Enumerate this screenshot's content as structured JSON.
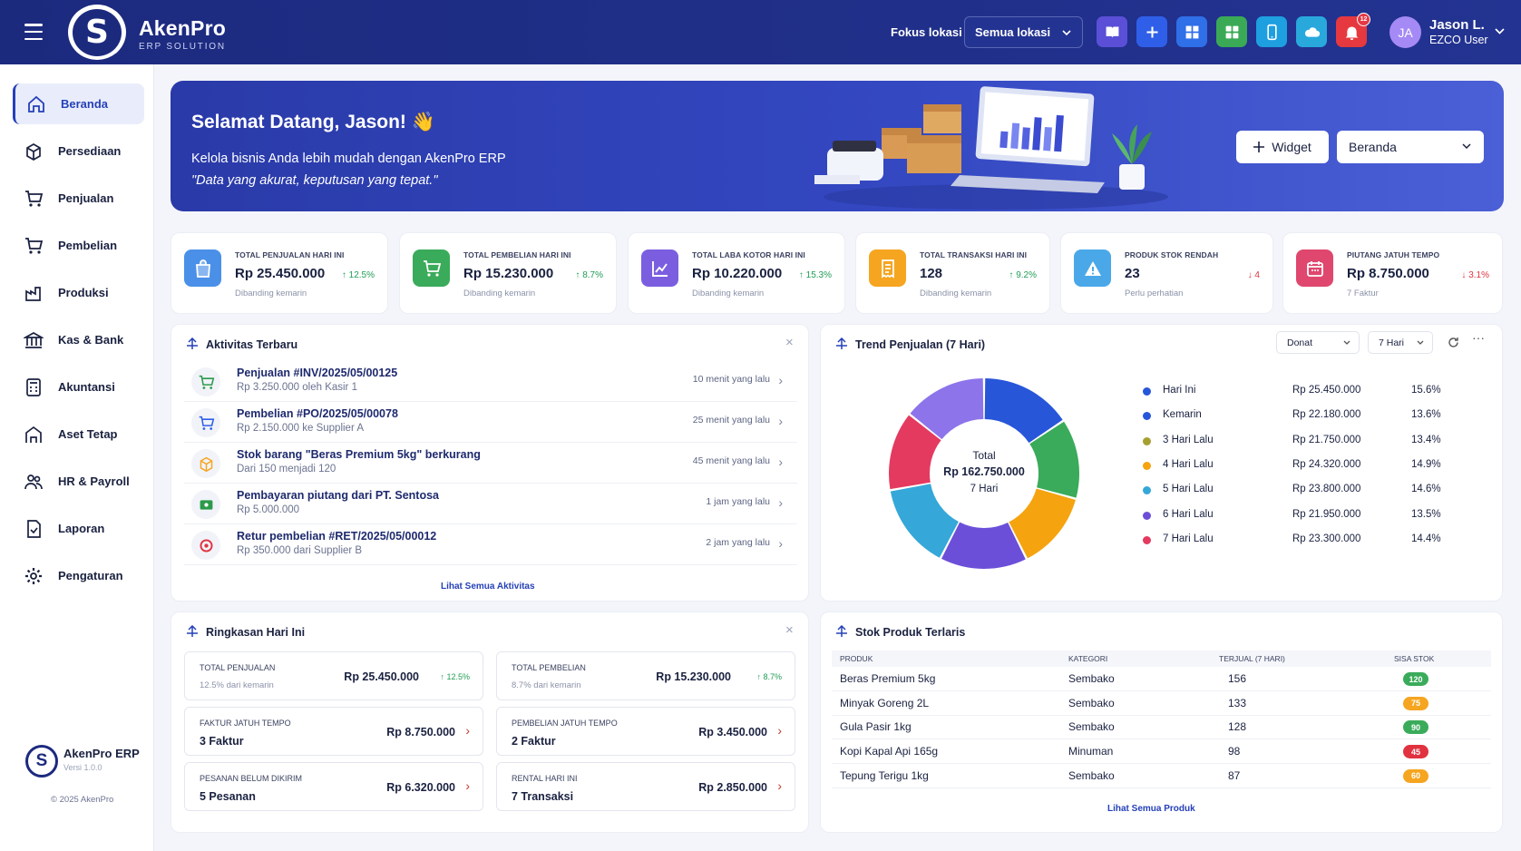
{
  "app": {
    "name": "AkenPro",
    "tagline": "ERP SOLUTION",
    "logo_letter": "S"
  },
  "topbar": {
    "focus_label": "Fokus lokasi",
    "location_select": "Semua lokasi",
    "notification_count": "12",
    "buttons": [
      {
        "icon": "book-icon",
        "color": "#5a4fd6"
      },
      {
        "icon": "plus-icon",
        "color": "#2f5fe8"
      },
      {
        "icon": "grid-icon",
        "color": "#2f6fe8"
      },
      {
        "icon": "apps-icon",
        "color": "#3aaa57"
      },
      {
        "icon": "mobile-icon",
        "color": "#1e9fe0"
      },
      {
        "icon": "cloud-icon",
        "color": "#29a8dc"
      },
      {
        "icon": "bell-icon",
        "color": "#e5393f"
      }
    ],
    "user": {
      "initials": "JA",
      "name": "Jason L.",
      "role": "EZCO User"
    }
  },
  "sidebar": {
    "items": [
      {
        "label": "Beranda",
        "icon": "home-icon",
        "active": true
      },
      {
        "label": "Persediaan",
        "icon": "box-icon"
      },
      {
        "label": "Penjualan",
        "icon": "cart-icon"
      },
      {
        "label": "Pembelian",
        "icon": "cart-icon"
      },
      {
        "label": "Produksi",
        "icon": "factory-icon"
      },
      {
        "label": "Kas & Bank",
        "icon": "bank-icon"
      },
      {
        "label": "Akuntansi",
        "icon": "calculator-icon"
      },
      {
        "label": "Aset Tetap",
        "icon": "building-icon"
      },
      {
        "label": "HR & Payroll",
        "icon": "people-icon"
      },
      {
        "label": "Laporan",
        "icon": "report-icon"
      },
      {
        "label": "Pengaturan",
        "icon": "gear-icon"
      }
    ],
    "footer": {
      "name": "AkenPro ERP",
      "version": "Versi 1.0.0",
      "copyright": "© 2025 AkenPro"
    }
  },
  "hero": {
    "title": "Selamat Datang, Jason! 👋",
    "subtitle": "Kelola bisnis Anda lebih mudah dengan AkenPro ERP",
    "quote": "\"Data yang akurat, keputusan yang tepat.\"",
    "widget_button": "Widget",
    "page_select": "Beranda"
  },
  "kpis": [
    {
      "label": "TOTAL PENJUALAN HARI INI",
      "value": "Rp 25.450.000",
      "change": "↑ 12.5%",
      "dir": "up",
      "note": "Dibanding kemarin",
      "icon": "shopping-bag-icon",
      "color": "#4a90e8"
    },
    {
      "label": "TOTAL PEMBELIAN HARI INI",
      "value": "Rp 15.230.000",
      "change": "↑ 8.7%",
      "dir": "up",
      "note": "Dibanding kemarin",
      "icon": "cart-icon",
      "color": "#3aab5a"
    },
    {
      "label": "TOTAL LABA KOTOR HARI INI",
      "value": "Rp 10.220.000",
      "change": "↑ 15.3%",
      "dir": "up",
      "note": "Dibanding kemarin",
      "icon": "chart-icon",
      "color": "#7b5ee0"
    },
    {
      "label": "TOTAL TRANSAKSI HARI INI",
      "value": "128",
      "change": "↑ 9.2%",
      "dir": "up",
      "note": "Dibanding kemarin",
      "icon": "receipt-icon",
      "color": "#f5a520"
    },
    {
      "label": "PRODUK STOK RENDAH",
      "value": "23",
      "change": "↓ 4",
      "dir": "down",
      "note": "Perlu perhatian",
      "icon": "warning-icon",
      "color": "#4aa8e8"
    },
    {
      "label": "PIUTANG JATUH TEMPO",
      "value": "Rp 8.750.000",
      "change": "↓ 3.1%",
      "dir": "down",
      "note": "7 Faktur",
      "icon": "calendar-icon",
      "color": "#e0476e"
    }
  ],
  "activity": {
    "title": "Aktivitas Terbaru",
    "link": "Lihat Semua Aktivitas",
    "items": [
      {
        "title": "Penjualan #INV/2025/05/00125",
        "sub": "Rp 3.250.000 oleh Kasir 1",
        "time": "10 menit yang lalu",
        "icon": "cart-icon",
        "color": "#2c9a4a"
      },
      {
        "title": "Pembelian #PO/2025/05/00078",
        "sub": "Rp 2.150.000 ke Supplier A",
        "time": "25 menit yang lalu",
        "icon": "cart-icon",
        "color": "#2f5fe8"
      },
      {
        "title": "Stok barang \"Beras Premium 5kg\" berkurang",
        "sub": "Dari 150 menjadi 120",
        "time": "45 menit yang lalu",
        "icon": "box-icon",
        "color": "#f5a520"
      },
      {
        "title": "Pembayaran piutang dari PT. Sentosa",
        "sub": "Rp 5.000.000",
        "time": "1 jam yang lalu",
        "icon": "money-icon",
        "color": "#2c9a4a"
      },
      {
        "title": "Retur pembelian #RET/2025/05/00012",
        "sub": "Rp 350.000 dari Supplier B",
        "time": "2 jam yang lalu",
        "icon": "return-icon",
        "color": "#e0333f"
      }
    ]
  },
  "trend": {
    "title": "Trend Penjualan (7 Hari)",
    "chart_type_select": "Donat",
    "range_select": "7 Hari",
    "center_label": "Total",
    "center_value": "Rp 162.750.000",
    "center_sub": "7 Hari"
  },
  "chart_data": {
    "type": "pie",
    "series": [
      {
        "name": "Hari Ini",
        "value": 25450000,
        "display": "Rp 25.450.000",
        "percent": "15.6%",
        "color": "#2756d9"
      },
      {
        "name": "Kemarin",
        "value": 22180000,
        "display": "Rp 22.180.000",
        "percent": "13.6%",
        "color": "#3aab5a"
      },
      {
        "name": "3 Hari Lalu",
        "value": 21750000,
        "display": "Rp 21.750.000",
        "percent": "13.4%",
        "color": "#f5a30f"
      },
      {
        "name": "4 Hari Lalu",
        "value": 24320000,
        "display": "Rp 24.320.000",
        "percent": "14.9%",
        "color": "#6c4fd8"
      },
      {
        "name": "5 Hari Lalu",
        "value": 23800000,
        "display": "Rp 23.800.000",
        "percent": "14.6%",
        "color": "#35a7d8"
      },
      {
        "name": "6 Hari Lalu",
        "value": 21950000,
        "display": "Rp 21.950.000",
        "percent": "13.5%",
        "color": "#e43a60"
      },
      {
        "name": "7 Hari Lalu",
        "value": 23300000,
        "display": "Rp 23.300.000",
        "percent": "14.4%",
        "color": "#8d74ea"
      }
    ],
    "legend_series": [
      {
        "name": "Hari Ini",
        "display": "Rp 25.450.000",
        "percent": "15.6%",
        "color": "#2756d9"
      },
      {
        "name": "Kemarin",
        "display": "Rp 22.180.000",
        "percent": "13.6%",
        "color": "#2756d9"
      },
      {
        "name": "3 Hari Lalu",
        "display": "Rp 21.750.000",
        "percent": "13.4%",
        "color": "#a6a032"
      },
      {
        "name": "4 Hari Lalu",
        "display": "Rp 24.320.000",
        "percent": "14.9%",
        "color": "#f5a30f"
      },
      {
        "name": "5 Hari Lalu",
        "display": "Rp 23.800.000",
        "percent": "14.6%",
        "color": "#35a7d8"
      },
      {
        "name": "6 Hari Lalu",
        "display": "Rp 21.950.000",
        "percent": "13.5%",
        "color": "#6c4fd8"
      },
      {
        "name": "7 Hari Lalu",
        "display": "Rp 23.300.000",
        "percent": "14.4%",
        "color": "#e43a60"
      }
    ]
  },
  "summary": {
    "title": "Ringkasan Hari Ini",
    "items": [
      {
        "label": "TOTAL PENJUALAN",
        "value": "Rp 25.450.000",
        "pct": "↑ 12.5%",
        "sub": "12.5% dari kemarin"
      },
      {
        "label": "TOTAL PEMBELIAN",
        "value": "Rp 15.230.000",
        "pct": "↑ 8.7%",
        "sub": "8.7% dari kemarin"
      },
      {
        "label": "FAKTUR JATUH TEMPO",
        "value": "Rp 8.750.000",
        "big": "3 Faktur"
      },
      {
        "label": "PEMBELIAN JATUH TEMPO",
        "value": "Rp 3.450.000",
        "big": "2 Faktur"
      },
      {
        "label": "PESANAN BELUM DIKIRIM",
        "value": "Rp 6.320.000",
        "big": "5 Pesanan"
      },
      {
        "label": "RENTAL HARI INI",
        "value": "Rp 2.850.000",
        "big": "7 Transaksi"
      }
    ]
  },
  "stock": {
    "title": "Stok Produk Terlaris",
    "headers": [
      "PRODUK",
      "KATEGORI",
      "TERJUAL (7 HARI)",
      "SISA STOK"
    ],
    "rows": [
      {
        "product": "Beras Premium 5kg",
        "category": "Sembako",
        "sold": "156",
        "stock": "120",
        "color": "#3aab5a"
      },
      {
        "product": "Minyak Goreng 2L",
        "category": "Sembako",
        "sold": "133",
        "stock": "75",
        "color": "#f5a520"
      },
      {
        "product": "Gula Pasir 1kg",
        "category": "Sembako",
        "sold": "128",
        "stock": "90",
        "color": "#3aab5a"
      },
      {
        "product": "Kopi Kapal Api 165g",
        "category": "Minuman",
        "sold": "98",
        "stock": "45",
        "color": "#e0333f"
      },
      {
        "product": "Tepung Terigu 1kg",
        "category": "Sembako",
        "sold": "87",
        "stock": "60",
        "color": "#f5a520"
      }
    ],
    "link": "Lihat Semua Produk"
  }
}
